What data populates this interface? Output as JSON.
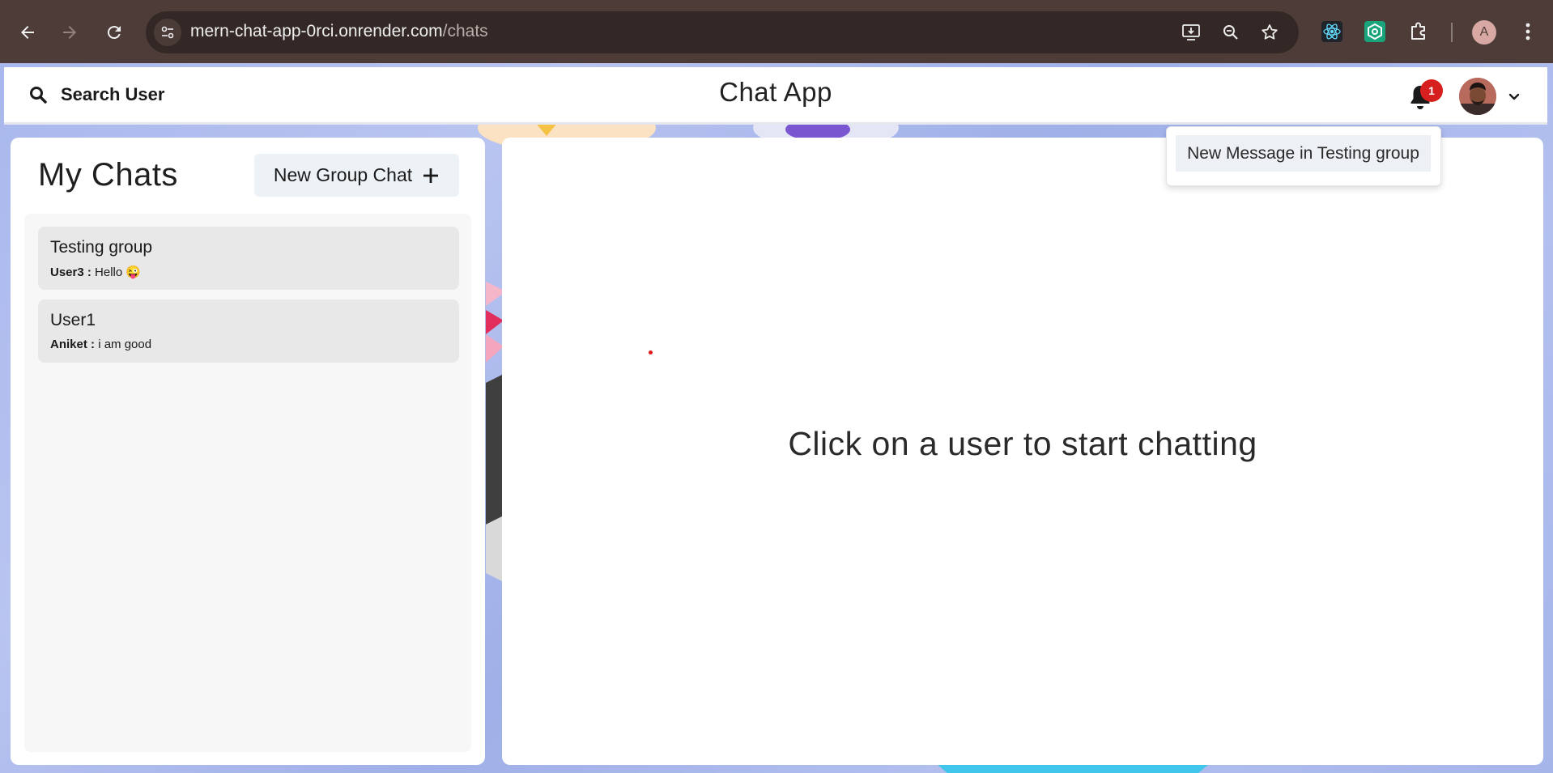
{
  "browser": {
    "url_host": "mern-chat-app-0rci.onrender.com",
    "url_path": "/chats",
    "profile_initial": "A",
    "icons": [
      "back-arrow-icon",
      "forward-arrow-icon",
      "reload-icon",
      "site-info-icon",
      "install-app-icon",
      "zoom-icon",
      "bookmark-star-icon",
      "react-devtools-icon",
      "extension-green-icon",
      "extensions-puzzle-icon",
      "profile-icon",
      "kebab-menu-icon"
    ]
  },
  "header": {
    "search_label": "Search User",
    "title": "Chat App",
    "notification_count": "1"
  },
  "notifications": {
    "items": [
      "New Message in Testing group"
    ]
  },
  "my_chats": {
    "title": "My Chats",
    "new_group_label": "New Group Chat",
    "chats": [
      {
        "name": "Testing group",
        "sender": "User3 :",
        "message": "Hello 😜"
      },
      {
        "name": "User1",
        "sender": "Aniket :",
        "message": "i am good"
      }
    ]
  },
  "chat_box": {
    "empty_text": "Click on a user to start chatting"
  },
  "colors": {
    "chrome_bg": "#4d3c38",
    "badge_red": "#d61f1f",
    "panel_bg": "#ffffff",
    "chat_item_bg": "#e8e8e8"
  }
}
